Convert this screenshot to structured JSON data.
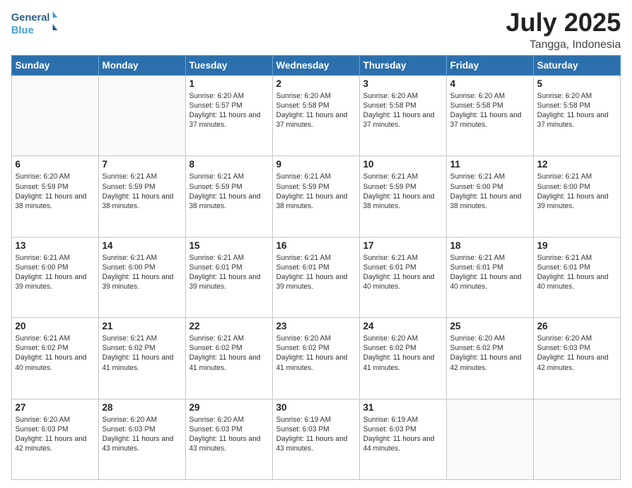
{
  "header": {
    "logo_line1": "General",
    "logo_line2": "Blue",
    "month_title": "July 2025",
    "location": "Tangga, Indonesia"
  },
  "weekdays": [
    "Sunday",
    "Monday",
    "Tuesday",
    "Wednesday",
    "Thursday",
    "Friday",
    "Saturday"
  ],
  "weeks": [
    [
      {
        "day": "",
        "info": ""
      },
      {
        "day": "",
        "info": ""
      },
      {
        "day": "1",
        "info": "Sunrise: 6:20 AM\nSunset: 5:57 PM\nDaylight: 11 hours and 37 minutes."
      },
      {
        "day": "2",
        "info": "Sunrise: 6:20 AM\nSunset: 5:58 PM\nDaylight: 11 hours and 37 minutes."
      },
      {
        "day": "3",
        "info": "Sunrise: 6:20 AM\nSunset: 5:58 PM\nDaylight: 11 hours and 37 minutes."
      },
      {
        "day": "4",
        "info": "Sunrise: 6:20 AM\nSunset: 5:58 PM\nDaylight: 11 hours and 37 minutes."
      },
      {
        "day": "5",
        "info": "Sunrise: 6:20 AM\nSunset: 5:58 PM\nDaylight: 11 hours and 37 minutes."
      }
    ],
    [
      {
        "day": "6",
        "info": "Sunrise: 6:20 AM\nSunset: 5:59 PM\nDaylight: 11 hours and 38 minutes."
      },
      {
        "day": "7",
        "info": "Sunrise: 6:21 AM\nSunset: 5:59 PM\nDaylight: 11 hours and 38 minutes."
      },
      {
        "day": "8",
        "info": "Sunrise: 6:21 AM\nSunset: 5:59 PM\nDaylight: 11 hours and 38 minutes."
      },
      {
        "day": "9",
        "info": "Sunrise: 6:21 AM\nSunset: 5:59 PM\nDaylight: 11 hours and 38 minutes."
      },
      {
        "day": "10",
        "info": "Sunrise: 6:21 AM\nSunset: 5:59 PM\nDaylight: 11 hours and 38 minutes."
      },
      {
        "day": "11",
        "info": "Sunrise: 6:21 AM\nSunset: 6:00 PM\nDaylight: 11 hours and 38 minutes."
      },
      {
        "day": "12",
        "info": "Sunrise: 6:21 AM\nSunset: 6:00 PM\nDaylight: 11 hours and 39 minutes."
      }
    ],
    [
      {
        "day": "13",
        "info": "Sunrise: 6:21 AM\nSunset: 6:00 PM\nDaylight: 11 hours and 39 minutes."
      },
      {
        "day": "14",
        "info": "Sunrise: 6:21 AM\nSunset: 6:00 PM\nDaylight: 11 hours and 39 minutes."
      },
      {
        "day": "15",
        "info": "Sunrise: 6:21 AM\nSunset: 6:01 PM\nDaylight: 11 hours and 39 minutes."
      },
      {
        "day": "16",
        "info": "Sunrise: 6:21 AM\nSunset: 6:01 PM\nDaylight: 11 hours and 39 minutes."
      },
      {
        "day": "17",
        "info": "Sunrise: 6:21 AM\nSunset: 6:01 PM\nDaylight: 11 hours and 40 minutes."
      },
      {
        "day": "18",
        "info": "Sunrise: 6:21 AM\nSunset: 6:01 PM\nDaylight: 11 hours and 40 minutes."
      },
      {
        "day": "19",
        "info": "Sunrise: 6:21 AM\nSunset: 6:01 PM\nDaylight: 11 hours and 40 minutes."
      }
    ],
    [
      {
        "day": "20",
        "info": "Sunrise: 6:21 AM\nSunset: 6:02 PM\nDaylight: 11 hours and 40 minutes."
      },
      {
        "day": "21",
        "info": "Sunrise: 6:21 AM\nSunset: 6:02 PM\nDaylight: 11 hours and 41 minutes."
      },
      {
        "day": "22",
        "info": "Sunrise: 6:21 AM\nSunset: 6:02 PM\nDaylight: 11 hours and 41 minutes."
      },
      {
        "day": "23",
        "info": "Sunrise: 6:20 AM\nSunset: 6:02 PM\nDaylight: 11 hours and 41 minutes."
      },
      {
        "day": "24",
        "info": "Sunrise: 6:20 AM\nSunset: 6:02 PM\nDaylight: 11 hours and 41 minutes."
      },
      {
        "day": "25",
        "info": "Sunrise: 6:20 AM\nSunset: 6:02 PM\nDaylight: 11 hours and 42 minutes."
      },
      {
        "day": "26",
        "info": "Sunrise: 6:20 AM\nSunset: 6:03 PM\nDaylight: 11 hours and 42 minutes."
      }
    ],
    [
      {
        "day": "27",
        "info": "Sunrise: 6:20 AM\nSunset: 6:03 PM\nDaylight: 11 hours and 42 minutes."
      },
      {
        "day": "28",
        "info": "Sunrise: 6:20 AM\nSunset: 6:03 PM\nDaylight: 11 hours and 43 minutes."
      },
      {
        "day": "29",
        "info": "Sunrise: 6:20 AM\nSunset: 6:03 PM\nDaylight: 11 hours and 43 minutes."
      },
      {
        "day": "30",
        "info": "Sunrise: 6:19 AM\nSunset: 6:03 PM\nDaylight: 11 hours and 43 minutes."
      },
      {
        "day": "31",
        "info": "Sunrise: 6:19 AM\nSunset: 6:03 PM\nDaylight: 11 hours and 44 minutes."
      },
      {
        "day": "",
        "info": ""
      },
      {
        "day": "",
        "info": ""
      }
    ]
  ]
}
